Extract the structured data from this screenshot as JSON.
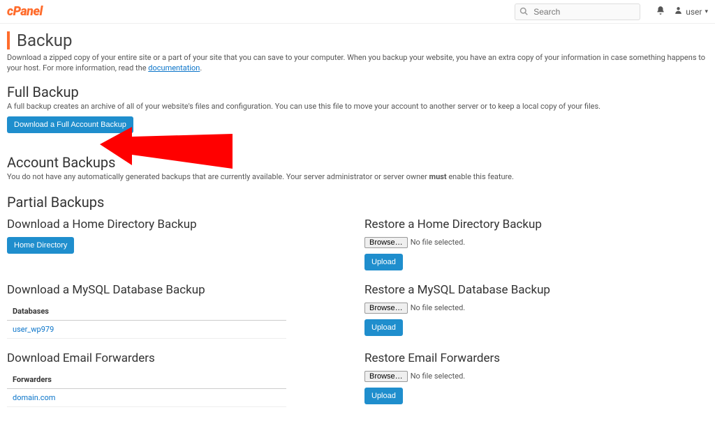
{
  "topbar": {
    "logo_cp": "cPanel",
    "search_placeholder": "Search",
    "user_label": "user"
  },
  "page": {
    "title": "Backup",
    "intro_before": "Download a zipped copy of your entire site or a part of your site that you can save to your computer. When you backup your website, you have an extra copy of your information in case something happens to your host. For more information, read the ",
    "intro_link": "documentation",
    "intro_after": "."
  },
  "full_backup": {
    "heading": "Full Backup",
    "desc": "A full backup creates an archive of all of your website's files and configuration. You can use this file to move your account to another server or to keep a local copy of your files.",
    "button": "Download a Full Account Backup"
  },
  "account_backups": {
    "heading": "Account Backups",
    "desc_before": "You do not have any automatically generated backups that are currently available. Your server administrator or server owner ",
    "desc_strong": "must",
    "desc_after": " enable this feature."
  },
  "partial": {
    "heading": "Partial Backups",
    "home_dl_heading": "Download a Home Directory Backup",
    "home_dl_button": "Home Directory",
    "home_restore_heading": "Restore a Home Directory Backup",
    "browse_label": "Browse…",
    "no_file": "No file selected.",
    "upload_label": "Upload",
    "mysql_dl_heading": "Download a MySQL Database Backup",
    "mysql_restore_heading": "Restore a MySQL Database Backup",
    "db_table_header": "Databases",
    "db_name": "user_wp979",
    "email_dl_heading": "Download Email Forwarders",
    "email_restore_heading": "Restore Email Forwarders",
    "fwd_table_header": "Forwarders",
    "fwd_name": "domain.com"
  }
}
